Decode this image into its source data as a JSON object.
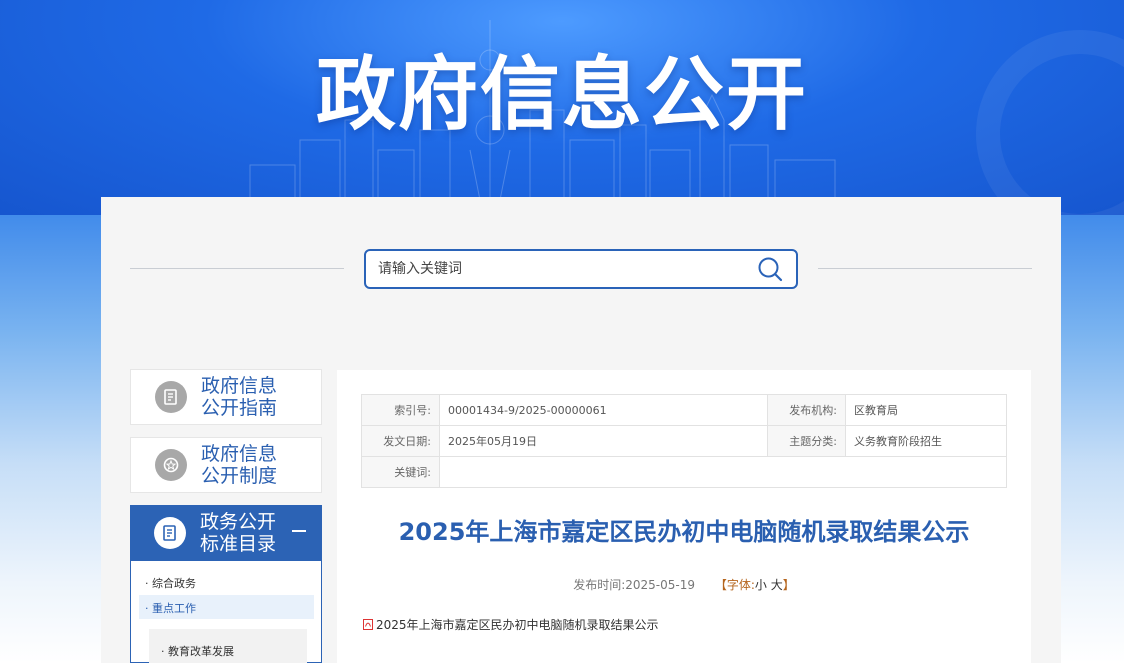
{
  "banner": {
    "title": "政府信息公开"
  },
  "search": {
    "placeholder": "请输入关键词"
  },
  "sidebar": {
    "items": [
      {
        "line1": "政府信息",
        "line2": "公开指南"
      },
      {
        "line1": "政府信息",
        "line2": "公开制度"
      },
      {
        "line1": "政务公开",
        "line2": "标准目录"
      }
    ],
    "sub_items": [
      {
        "label": "综合政务"
      },
      {
        "label": "重点工作"
      }
    ],
    "sub_sub_items": [
      {
        "label": "教育改革发展"
      }
    ]
  },
  "meta": {
    "index_label": "索引号:",
    "index_value": "00001434-9/2025-00000061",
    "publisher_label": "发布机构:",
    "publisher_value": "区教育局",
    "date_label": "发文日期:",
    "date_value": "2025年05月19日",
    "topic_label": "主题分类:",
    "topic_value": "义务教育阶段招生",
    "keyword_label": "关键词:",
    "keyword_value": ""
  },
  "article": {
    "title": "2025年上海市嘉定区民办初中电脑随机录取结果公示",
    "publish_prefix": "发布时间:",
    "publish_date": "2025-05-19",
    "font_open": "【字体:",
    "font_small": "小",
    "font_large": "大",
    "font_close": "】",
    "attachment": "2025年上海市嘉定区民办初中电脑随机录取结果公示"
  },
  "colors": {
    "brand": "#2a5fb0",
    "active": "#2c63b5"
  }
}
